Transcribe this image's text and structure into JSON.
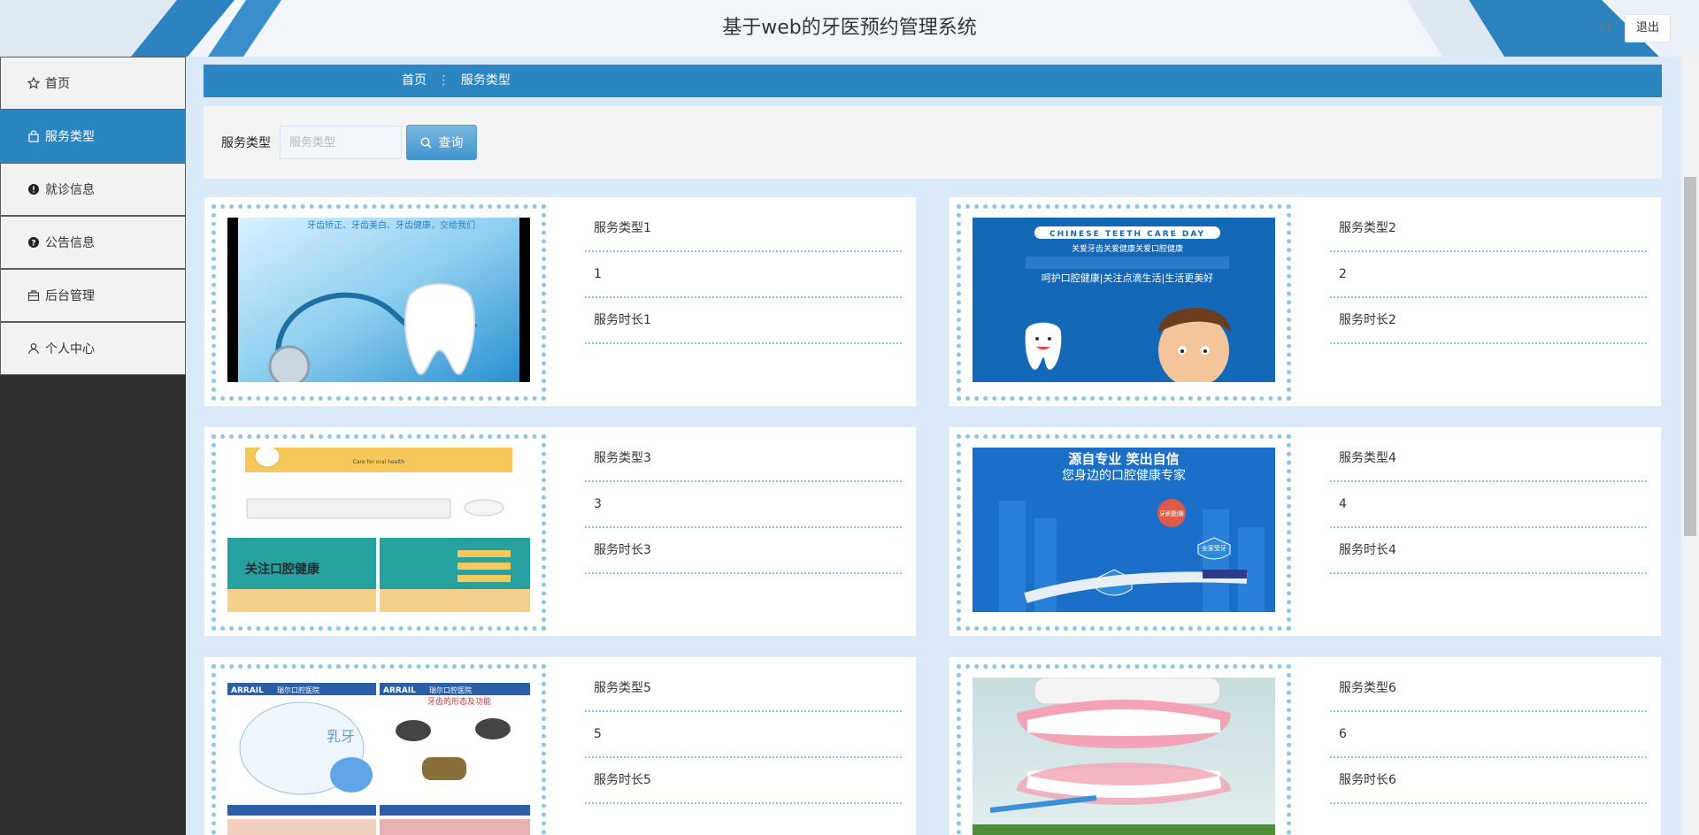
{
  "header": {
    "title": "基于web的牙医预约管理系统",
    "user": "11",
    "logout_label": "退出"
  },
  "sidebar": {
    "items": [
      {
        "label": "首页",
        "icon": "star-icon",
        "active": false
      },
      {
        "label": "服务类型",
        "icon": "bag-icon",
        "active": true
      },
      {
        "label": "就诊信息",
        "icon": "alert-circle-icon",
        "active": false
      },
      {
        "label": "公告信息",
        "icon": "help-circle-icon",
        "active": false
      },
      {
        "label": "后台管理",
        "icon": "briefcase-icon",
        "active": false
      },
      {
        "label": "个人中心",
        "icon": "user-icon",
        "active": false
      }
    ]
  },
  "breadcrumb": {
    "home": "首页",
    "separator": "⋮",
    "current": "服务类型"
  },
  "search": {
    "label": "服务类型",
    "placeholder": "服务类型",
    "value": "",
    "button_label": "查询",
    "button_icon": "search-icon"
  },
  "cards": [
    {
      "name": "服务类型1",
      "number": "1",
      "duration": "服务时长1",
      "image": "stethoscope-tooth-photo"
    },
    {
      "name": "服务类型2",
      "number": "2",
      "duration": "服务时长2",
      "image": "teeth-care-day-poster"
    },
    {
      "name": "服务类型3",
      "number": "3",
      "duration": "服务时长3",
      "image": "oral-health-web-banners"
    },
    {
      "name": "服务类型4",
      "number": "4",
      "duration": "服务时长4",
      "image": "oral-health-expert-poster"
    },
    {
      "name": "服务类型5",
      "number": "5",
      "duration": "服务时长5",
      "image": "dental-clinic-leaflets"
    },
    {
      "name": "服务类型6",
      "number": "6",
      "duration": "服务时长6",
      "image": "dentures-model-photo"
    }
  ],
  "poster_text": {
    "card1_top": "牙齿矫正、牙齿美白、牙齿健康，交给我们",
    "card2_banner": "CHINESE TEETH CARE DAY",
    "card2_sub": "关爱牙齿关爱健康关爱口腔健康",
    "card2_line": "呵护口腔健康|关注点滴生活|生活更美好",
    "card3_banner": "Care for oral health",
    "card3_title": "关注口腔健康",
    "card4_title": "源自专业 笑出自信",
    "card4_sub": "您身边的口腔健康专家",
    "card4_tag1": "牙刷勤换",
    "card4_tag2": "睡前刷牙",
    "card4_tag3": "全家受牙",
    "card5_brand": "ARRAIL",
    "card5_clinic": "瑞尔口腔医院",
    "card5_sub": "牙齿的形态及功能",
    "card5_kid": "乳牙"
  },
  "colors": {
    "primary": "#2b85c1",
    "sidebar_bg": "#313131",
    "main_bg": "#dbeaf9",
    "dot_border": "#8ec6e6"
  }
}
